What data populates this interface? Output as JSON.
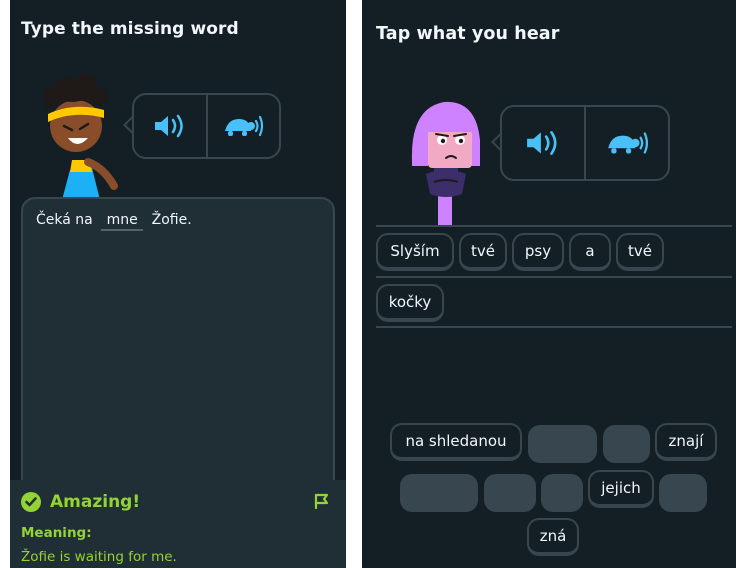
{
  "left": {
    "title": "Type the missing word",
    "sentence": {
      "before": "Čeká na",
      "answer": "mne",
      "after": "Žofie."
    },
    "feedback": {
      "title": "Amazing!",
      "meaning_label": "Meaning:",
      "meaning_text": "Žofie is waiting for me."
    }
  },
  "right": {
    "title": "Tap what you hear",
    "answer_words": [
      "Slyším",
      "tvé",
      "psy",
      "a",
      "tvé",
      "kočky"
    ],
    "bank_words": {
      "na_shledanou": "na shledanou",
      "znaji": "znají",
      "jejich": "jejich",
      "zna": "zná"
    }
  },
  "colors": {
    "background": "#131f24",
    "border": "#37464f",
    "speaker_blue": "#49c0f8",
    "success_green": "#93d333",
    "text": "#f1f7fb"
  },
  "icons": [
    "speaker-icon",
    "turtle-slow-icon",
    "check-icon",
    "flag-icon"
  ]
}
